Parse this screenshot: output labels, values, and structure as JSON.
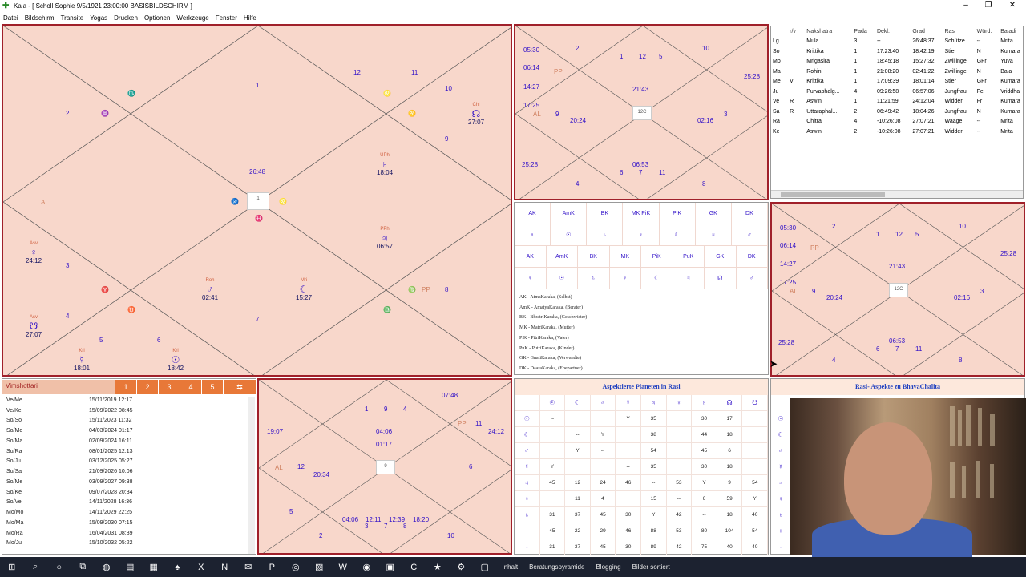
{
  "window": {
    "title": "Kala - [ Scholl Sophie 9/5/1921 23:00:00        BASISBILDSCHIRM ]",
    "minimize": "–",
    "maximize": "❐",
    "close": "✕"
  },
  "menu": [
    "Datei",
    "Bildschirm",
    "Transite",
    "Yogas",
    "Drucken",
    "Optionen",
    "Werkzeuge",
    "Fenster",
    "Hilfe"
  ],
  "rasi": {
    "houses": [
      "1",
      "2",
      "3",
      "4",
      "5",
      "6",
      "7",
      "8",
      "9",
      "10",
      "11",
      "12"
    ],
    "center_num": "1",
    "asc_time": "26:48",
    "signs": [
      "♏",
      "♐",
      "♑",
      "♒",
      "♓",
      "♈",
      "♉",
      "♊",
      "♋",
      "♌",
      "♍",
      "♎",
      "♓",
      "♈",
      "♉",
      "♊",
      "♌",
      "♍"
    ],
    "labels": {
      "al": "AL",
      "pp": "PP"
    },
    "planets": [
      {
        "name": "Chi",
        "glyph": "☊",
        "val": "27:07"
      },
      {
        "name": "UPh",
        "glyph": "♄",
        "val": "18:04"
      },
      {
        "name": "PPh",
        "glyph": "♃",
        "val": "06:57"
      },
      {
        "name": "Roh",
        "glyph": "♂",
        "val": "02:41"
      },
      {
        "name": "Mri",
        "glyph": "☾",
        "val": "15:27"
      },
      {
        "name": "Asv",
        "glyph": "♀",
        "val": "24:12"
      },
      {
        "name": "Asv",
        "glyph": "☋",
        "val": "27:07"
      },
      {
        "name": "Kri",
        "glyph": "☿",
        "val": "18:01"
      },
      {
        "name": "Kri",
        "glyph": "☉",
        "val": "18:42"
      }
    ]
  },
  "navamsa": {
    "houses": [
      "2",
      "1",
      "12",
      "5",
      "10",
      "9",
      "3",
      "4",
      "6",
      "7",
      "11",
      "8"
    ],
    "center_label": "12C",
    "labels": {
      "al": "AL",
      "pp": "PP"
    },
    "values": [
      "05:30",
      "06:14",
      "14:27",
      "17:25",
      "21:43",
      "20:24",
      "02:16",
      "25:28",
      "25:28",
      "06:53"
    ]
  },
  "chalita": {
    "houses": [
      "2",
      "1",
      "12",
      "5",
      "10",
      "9",
      "3",
      "4",
      "6",
      "7",
      "11",
      "8"
    ],
    "center_label": "12C",
    "labels": {
      "al": "AL",
      "pp": "PP"
    },
    "values": [
      "05:30",
      "06:14",
      "14:27",
      "17:25",
      "21:43",
      "20:24",
      "02:16",
      "25:28",
      "25:28",
      "06:53"
    ]
  },
  "dasamsa": {
    "houses": [
      "1",
      "9",
      "4",
      "12",
      "11",
      "6",
      "2",
      "3",
      "5",
      "7",
      "8",
      "10"
    ],
    "center_num": "9",
    "labels": {
      "al": "AL",
      "pp": "PP"
    },
    "values": [
      "07:48",
      "19:07",
      "04:06",
      "01:17",
      "24:12",
      "20:34",
      "04:06",
      "12:11",
      "12:39",
      "18:20"
    ]
  },
  "planet_table": {
    "headers": [
      "",
      "r/v",
      "Nakshatra",
      "Pada",
      "Dekl.",
      "Grad",
      "Rasi",
      "Würd.",
      "Baladi"
    ],
    "rows": [
      [
        "Lg",
        "",
        "Mula",
        "3",
        "--",
        "26:48:37",
        "Schütze",
        "--",
        "Mrita"
      ],
      [
        "So",
        "",
        "Krittika",
        "1",
        "17:23:40",
        "18:42:19",
        "Stier",
        "N",
        "Kumara"
      ],
      [
        "Mo",
        "",
        "Mrigasira",
        "1",
        "18:45:18",
        "15:27:32",
        "Zwillinge",
        "GFr",
        "Yuva"
      ],
      [
        "Ma",
        "",
        "Rohini",
        "1",
        "21:08:20",
        "02:41:22",
        "Zwillinge",
        "N",
        "Bala"
      ],
      [
        "Me",
        "V",
        "Krittika",
        "1",
        "17:09:39",
        "18:01:14",
        "Stier",
        "GFr",
        "Kumara"
      ],
      [
        "Ju",
        "",
        "Purvaphalg...",
        "4",
        "09:26:58",
        "06:57:06",
        "Jungfrau",
        "Fe",
        "Vriddha"
      ],
      [
        "Ve",
        "R",
        "Aswini",
        "1",
        "11:21:59",
        "24:12:04",
        "Widder",
        "Fr",
        "Kumara"
      ],
      [
        "Sa",
        "R",
        "Uttaraphal...",
        "2",
        "06:49:42",
        "18:04:26",
        "Jungfrau",
        "N",
        "Kumara"
      ],
      [
        "Ra",
        "",
        "Chitra",
        "4",
        "-10:26:08",
        "27:07:21",
        "Waage",
        "--",
        "Mrita"
      ],
      [
        "Ke",
        "",
        "Aswini",
        "2",
        "-10:26:08",
        "27:07:21",
        "Widder",
        "--",
        "Mrita"
      ]
    ]
  },
  "karaka": {
    "row1": [
      "AK",
      "AmK",
      "BK",
      "MK PiK",
      "PiK",
      "GK",
      "DK"
    ],
    "row1_planets": [
      "♀",
      "☉",
      "♄",
      "♀",
      "☾",
      "♃",
      "♂"
    ],
    "row2": [
      "AK",
      "AmK",
      "BK",
      "MK",
      "PiK",
      "PuK",
      "GK",
      "DK"
    ],
    "row2_planets": [
      "♀",
      "☉",
      "♄",
      "♀",
      "☾",
      "♃",
      "☊",
      "♂"
    ],
    "legend": [
      "AK - AtmaKaraka, (Selbst)",
      "AmK - AmatyaKaraka, (Berater)",
      "BK - BhratriKaraka, (Geschwister)",
      "MK - MatriKaraka, (Mutter)",
      "PiK - PitriKaraka, (Vater)",
      "PuK - PutriKaraka, (Kinder)",
      "GK - GnatiKaraka, (Verwandte)",
      "DK - DaaraKaraka, (Ehepartner)"
    ]
  },
  "vimshottari": {
    "title": "Vimshottari",
    "tabs": [
      "1",
      "2",
      "3",
      "4",
      "5"
    ],
    "nav": "⇆",
    "rows": [
      [
        "Ve/Me",
        "15/11/2019 12:17"
      ],
      [
        "Ve/Ke",
        "15/09/2022 08:45"
      ],
      [
        "So/So",
        "15/11/2023 11:32"
      ],
      [
        "So/Mo",
        "04/03/2024 01:17"
      ],
      [
        "So/Ma",
        "02/09/2024 16:11"
      ],
      [
        "So/Ra",
        "08/01/2025 12:13"
      ],
      [
        "So/Ju",
        "03/12/2025 05:27"
      ],
      [
        "So/Sa",
        "21/09/2026 10:06"
      ],
      [
        "So/Me",
        "03/09/2027 09:38"
      ],
      [
        "So/Ke",
        "09/07/2028 20:34"
      ],
      [
        "So/Ve",
        "14/11/2028 16:36"
      ],
      [
        "Mo/Mo",
        "14/11/2029 22:25"
      ],
      [
        "Mo/Ma",
        "15/09/2030 07:15"
      ],
      [
        "Mo/Ra",
        "16/04/2031 08:39"
      ],
      [
        "Mo/Ju",
        "15/10/2032 05:22"
      ]
    ]
  },
  "aspects_rasi": {
    "title": "Aspektierte Planeten in Rasi",
    "headers": [
      "",
      "☉",
      "☾",
      "♂",
      "☿",
      "♃",
      "♀",
      "♄",
      "☊",
      "☋"
    ],
    "rows": [
      [
        "☉",
        "--",
        "",
        "",
        "Y",
        "35",
        "",
        "30",
        "17",
        ""
      ],
      [
        "☾",
        "",
        "--",
        "Y",
        "",
        "38",
        "",
        "44",
        "18",
        ""
      ],
      [
        "♂",
        "",
        "Y",
        "--",
        "",
        "54",
        "",
        "45",
        "6",
        ""
      ],
      [
        "☿",
        "Y",
        "",
        "",
        "--",
        "35",
        "",
        "30",
        "18",
        ""
      ],
      [
        "♃",
        "45",
        "12",
        "24",
        "46",
        "--",
        "53",
        "Y",
        "9",
        "54"
      ],
      [
        "♀",
        "",
        "11",
        "4",
        "",
        "15",
        "--",
        "6",
        "59",
        "Y"
      ],
      [
        "♄",
        "31",
        "37",
        "45",
        "30",
        "Y",
        "42",
        "--",
        "18",
        "40"
      ],
      [
        "+",
        "45",
        "22",
        "29",
        "46",
        "88",
        "53",
        "80",
        "104",
        "54"
      ],
      [
        "-",
        "31",
        "37",
        "45",
        "30",
        "89",
        "42",
        "75",
        "40",
        "40"
      ]
    ]
  },
  "aspects_chalita": {
    "title": "Rasi- Aspekte zu  BhavaChalita",
    "side": [
      "☉",
      "☾",
      "♂",
      "☿",
      "♃",
      "♀",
      "♄",
      "+",
      "-"
    ]
  },
  "taskbar": {
    "icons": [
      "⊞",
      "⌕",
      "○",
      "⧉",
      "◍",
      "▤",
      "▦",
      "♠",
      "X",
      "N",
      "✉",
      "P",
      "◎",
      "▧",
      "W",
      "◉",
      "▣",
      "C",
      "★",
      "⚙",
      "▢"
    ],
    "labels": [
      "Inhalt",
      "Beratungspyramide",
      "Blogging",
      "Bilder sortiert"
    ]
  }
}
